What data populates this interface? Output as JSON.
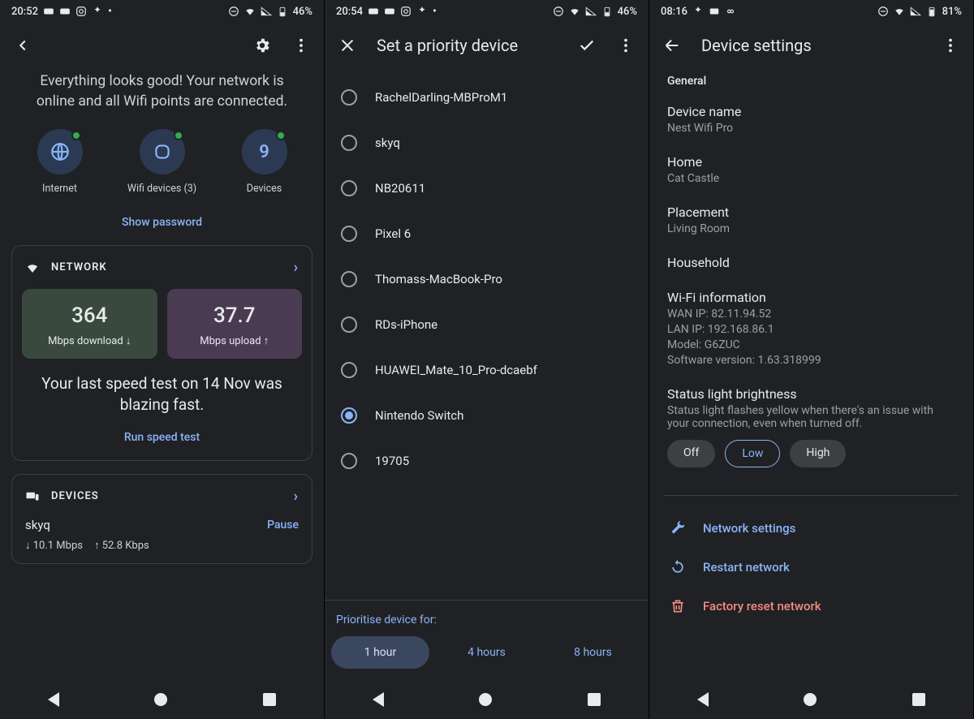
{
  "phones": [
    {
      "status": {
        "time": "20:52",
        "battery": "46%"
      },
      "banner": "Everything looks good! Your network is online and all Wifi points are connected.",
      "tiles": {
        "internet": "Internet",
        "wifi_devices": "Wifi devices (3)",
        "devices": "Devices",
        "devices_count": "9"
      },
      "show_password": "Show password",
      "network": {
        "heading": "NETWORK",
        "dl_value": "364",
        "dl_unit": "Mbps download ↓",
        "ul_value": "37.7",
        "ul_unit": "Mbps upload ↑",
        "message": "Your last speed test on 14 Nov was blazing fast.",
        "run": "Run speed test"
      },
      "devices": {
        "heading": "DEVICES",
        "row1_name": "skyq",
        "pause": "Pause",
        "row1_down": "↓ 10.1 Mbps",
        "row1_up": "↑ 52.8 Kbps"
      }
    },
    {
      "status": {
        "time": "20:54",
        "battery": "46%"
      },
      "title": "Set a priority device",
      "devices": [
        "RachelDarling-MBProM1",
        "skyq",
        "NB20611",
        "Pixel 6",
        "Thomass-MacBook-Pro",
        "RDs-iPhone",
        "HUAWEI_Mate_10_Pro-dcaebf",
        "Nintendo Switch",
        "19705"
      ],
      "selected_index": 7,
      "footer_label": "Prioritise device for:",
      "durations": [
        "1 hour",
        "4 hours",
        "8 hours"
      ],
      "selected_duration": 0
    },
    {
      "status": {
        "time": "08:16",
        "battery": "81%"
      },
      "title": "Device settings",
      "general_label": "General",
      "device_name_k": "Device name",
      "device_name_v": "Nest Wifi Pro",
      "home_k": "Home",
      "home_v": "Cat Castle",
      "placement_k": "Placement",
      "placement_v": "Living Room",
      "household_k": "Household",
      "wifi_info_k": "Wi-Fi information",
      "wan": "WAN IP: 82.11.94.52",
      "lan": "LAN IP: 192.168.86.1",
      "model": "Model: G6ZUC",
      "sw": "Software version: 1.63.318999",
      "status_light_k": "Status light brightness",
      "status_light_v": "Status light flashes yellow when there's an issue with your connection, even when turned off.",
      "brightness": {
        "off": "Off",
        "low": "Low",
        "high": "High",
        "selected": "low"
      },
      "actions": {
        "network_settings": "Network settings",
        "restart": "Restart network",
        "factory_reset": "Factory reset network"
      }
    }
  ]
}
